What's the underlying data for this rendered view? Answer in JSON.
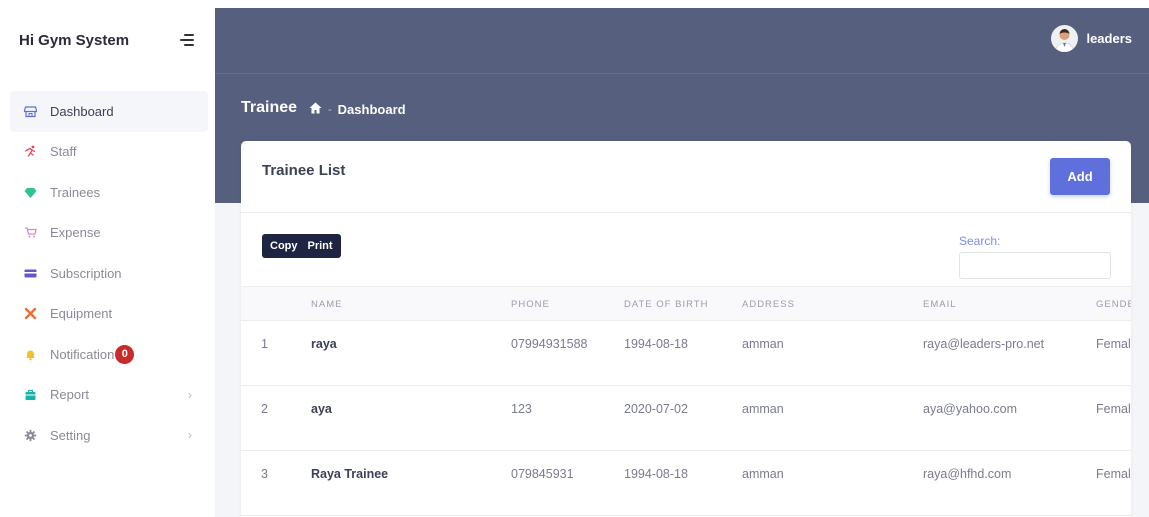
{
  "app": {
    "title": "Hi Gym System"
  },
  "sidebar": {
    "items": [
      {
        "label": "Dashboard",
        "icon": "store-icon",
        "active": true
      },
      {
        "label": "Staff",
        "icon": "running-icon"
      },
      {
        "label": "Trainees",
        "icon": "diamond-icon"
      },
      {
        "label": "Expense",
        "icon": "cart-icon"
      },
      {
        "label": "Subscription",
        "icon": "card-icon"
      },
      {
        "label": "Equipment",
        "icon": "tools-icon"
      },
      {
        "label": "Notification",
        "icon": "bell-icon",
        "badge": "0"
      },
      {
        "label": "Report",
        "icon": "bag-icon",
        "has_submenu": true
      },
      {
        "label": "Setting",
        "icon": "gear-icon",
        "has_submenu": true
      }
    ]
  },
  "user": {
    "name": "leaders"
  },
  "page": {
    "title": "Trainee",
    "breadcrumb": "Dashboard"
  },
  "card": {
    "title": "Trainee List",
    "add_label": "Add",
    "copy_label": "Copy",
    "print_label": "Print",
    "search_label": "Search:",
    "search_value": ""
  },
  "table": {
    "columns": [
      "NAME",
      "PHONE",
      "DATE OF BIRTH",
      "ADDRESS",
      "EMAIL",
      "GENDE"
    ],
    "rows": [
      {
        "index": "1",
        "name": "raya",
        "phone": "07994931588",
        "dob": "1994-08-18",
        "address": "amman",
        "email": "raya@leaders-pro.net",
        "gender": "Female"
      },
      {
        "index": "2",
        "name": "aya",
        "phone": "123",
        "dob": "2020-07-02",
        "address": "amman",
        "email": "aya@yahoo.com",
        "gender": "Female"
      },
      {
        "index": "3",
        "name": "Raya Trainee",
        "phone": "079845931",
        "dob": "1994-08-18",
        "address": "amman",
        "email": "raya@hfhd.com",
        "gender": "Female"
      }
    ]
  },
  "colors": {
    "header_bg": "#575f7f",
    "accent": "#5f6fdb",
    "dark_button": "#1e2542",
    "badge": "#c92a2a"
  }
}
